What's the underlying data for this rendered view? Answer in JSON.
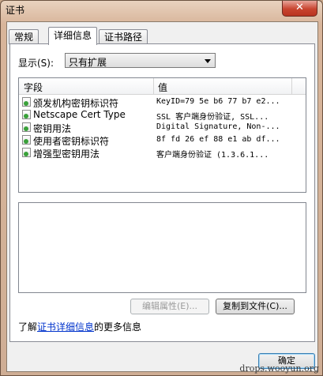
{
  "window": {
    "title": "证书",
    "close_label": "✕"
  },
  "tabs": [
    {
      "label": "常规"
    },
    {
      "label": "详细信息"
    },
    {
      "label": "证书路径"
    }
  ],
  "show": {
    "label": "显示(S):",
    "selected": "只有扩展"
  },
  "list": {
    "headers": {
      "field": "字段",
      "value": "值"
    },
    "rows": [
      {
        "field": "颁发机构密钥标识符",
        "value": "KeyID=79 5e b6 77 b7 e2..."
      },
      {
        "field": "Netscape Cert Type",
        "value": "SSL 客户端身份验证, SSL..."
      },
      {
        "field": "密钥用法",
        "value": "Digital Signature, Non-..."
      },
      {
        "field": "使用者密钥标识符",
        "value": "8f fd 26 ef 88 e1 ab df..."
      },
      {
        "field": "增强型密钥用法",
        "value": "客户端身份验证 (1.3.6.1..."
      }
    ]
  },
  "buttons": {
    "edit_properties": "编辑属性(E)...",
    "copy_to_file": "复制到文件(C)...",
    "ok": "确定"
  },
  "learn_more": {
    "prefix": "了解",
    "link": "证书详细信息",
    "suffix": "的更多信息"
  },
  "watermark": "drops.wooyun.org",
  "colors": {
    "link": "#0033cc",
    "close": "#c8442f"
  }
}
